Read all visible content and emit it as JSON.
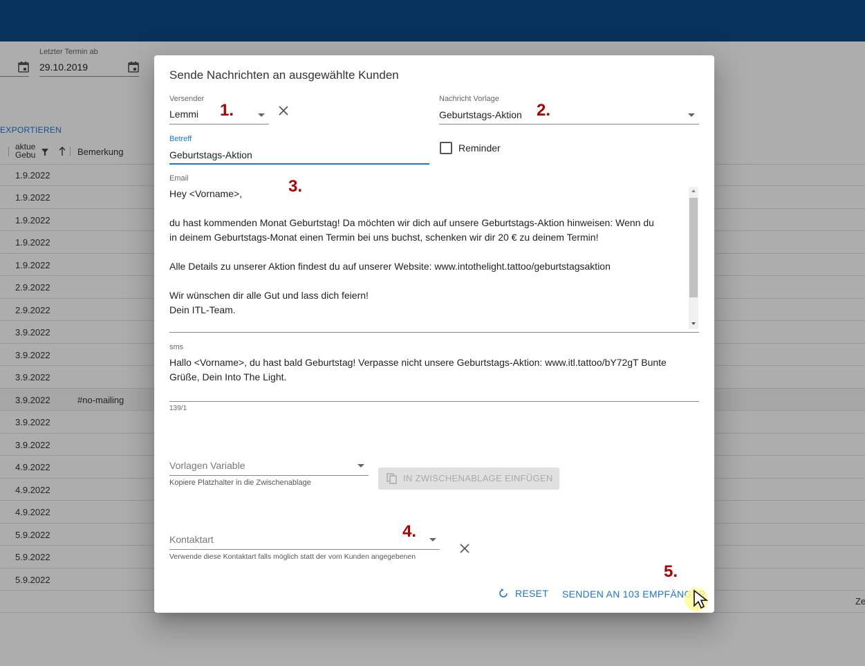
{
  "background": {
    "last_appointment_label": "Letzter Termin ab",
    "last_appointment_value": "29.10.2019",
    "export_label": "EXPORTIEREN",
    "col_current_birthday": "aktue\nGebu",
    "col_remark": "Bemerkung",
    "right_cut_text": "Ze",
    "rows": [
      {
        "date": "1.9.2022",
        "note": ""
      },
      {
        "date": "1.9.2022",
        "note": ""
      },
      {
        "date": "1.9.2022",
        "note": ""
      },
      {
        "date": "1.9.2022",
        "note": ""
      },
      {
        "date": "1.9.2022",
        "note": ""
      },
      {
        "date": "2.9.2022",
        "note": ""
      },
      {
        "date": "2.9.2022",
        "note": ""
      },
      {
        "date": "3.9.2022",
        "note": ""
      },
      {
        "date": "3.9.2022",
        "note": ""
      },
      {
        "date": "3.9.2022",
        "note": ""
      },
      {
        "date": "3.9.2022",
        "note": "#no-mailing"
      },
      {
        "date": "3.9.2022",
        "note": ""
      },
      {
        "date": "3.9.2022",
        "note": ""
      },
      {
        "date": "4.9.2022",
        "note": ""
      },
      {
        "date": "4.9.2022",
        "note": ""
      },
      {
        "date": "4.9.2022",
        "note": ""
      },
      {
        "date": "5.9.2022",
        "note": ""
      },
      {
        "date": "5.9.2022",
        "note": ""
      },
      {
        "date": "5.9.2022",
        "note": ""
      }
    ]
  },
  "dialog": {
    "title": "Sende Nachrichten an ausgewählte Kunden",
    "sender_label": "Versender",
    "sender_value": "Lemmi",
    "template_label": "Nachricht Vorlage",
    "template_value": "Geburtstags-Aktion",
    "subject_label": "Betreff",
    "subject_value": "Geburtstags-Aktion",
    "reminder_label": "Reminder",
    "email_label": "Email",
    "email_body": "Hey <Vorname>,\n\ndu hast kommenden Monat Geburtstag! Da möchten wir dich auf unsere Geburtstags-Aktion hinweisen: Wenn du\nin deinem Geburtstags-Monat einen Termin bei uns buchst, schenken wir dir 20 € zu deinem Termin!\n\nAlle Details zu unserer Aktion findest du auf unserer Website: www.intothelight.tattoo/geburtstagsaktion\n\nWir wünschen dir alle Gut und lass dich feiern!\nDein ITL-Team.",
    "sms_label": "sms",
    "sms_body": "Hallo <Vorname>, du hast bald Geburtstag! Verpasse nicht unsere Geburtstags-Aktion: www.itl.tattoo/bY72gT Bunte\nGrüße, Dein Into The Light.",
    "sms_counter": "139/1",
    "variable_placeholder": "Vorlagen Variable",
    "variable_hint": "Kopiere Platzhalter in die Zwischenablage",
    "clipboard_button": "IN ZWISCHENABLAGE EINFÜGEN",
    "contact_placeholder": "Kontaktart",
    "contact_hint": "Verwende diese Kontaktart falls möglich statt der vom Kunden angegebenen",
    "reset_button": "RESET",
    "send_button": "SENDEN AN 103 EMPFÄNGER"
  },
  "annotations": {
    "step1": "1.",
    "step2": "2.",
    "step3": "3.",
    "step4": "4.",
    "step5": "5."
  },
  "colors": {
    "topbar": "#0b4a8b",
    "primary": "#1976d2",
    "annotation": "#b00000"
  }
}
